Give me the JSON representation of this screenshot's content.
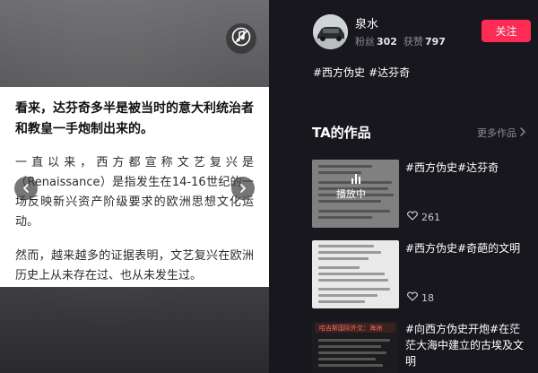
{
  "player": {
    "doc_title": "看来，达芬奇多半是被当时的意大利统治者和教皇一手炮制出来的。",
    "paragraph_1": "一直以来，西方都宣称文艺复兴是（Renaissance）是指发生在14-16世纪的一场反映新兴资产阶级要求的欧洲思想文化运动。",
    "paragraph_2": "然而，越来越多的证据表明，文艺复兴在欧洲历史上从未存在过、也从未发生过。",
    "icons": {
      "mute": "speaker-muted-icon",
      "prev": "chevron-left-icon",
      "next": "chevron-right-icon"
    }
  },
  "author": {
    "name": "泉水",
    "fans_label": "粉丝",
    "fans_count": "302",
    "likes_label": "获赞",
    "likes_count": "797",
    "follow_label": "关注",
    "tags": [
      "#西方伪史",
      "#达芬奇"
    ],
    "avatar_icon": "car-avatar-icon"
  },
  "works": {
    "section_title": "TA的作品",
    "more_label": "更多作品",
    "items": [
      {
        "title": "#西方伪史#达芬奇",
        "likes": "261",
        "status": "播放中"
      },
      {
        "title": "#西方伪史#奇葩的文明",
        "likes": "18"
      },
      {
        "title": "#向西方伪史开炮#在茫茫大海中建立的古埃及文明",
        "thumb_header": "哈吉斯国际外交：海洲"
      }
    ]
  },
  "colors": {
    "accent": "#fe2c55",
    "background": "#17171d",
    "muted_text": "#8a8a92"
  }
}
